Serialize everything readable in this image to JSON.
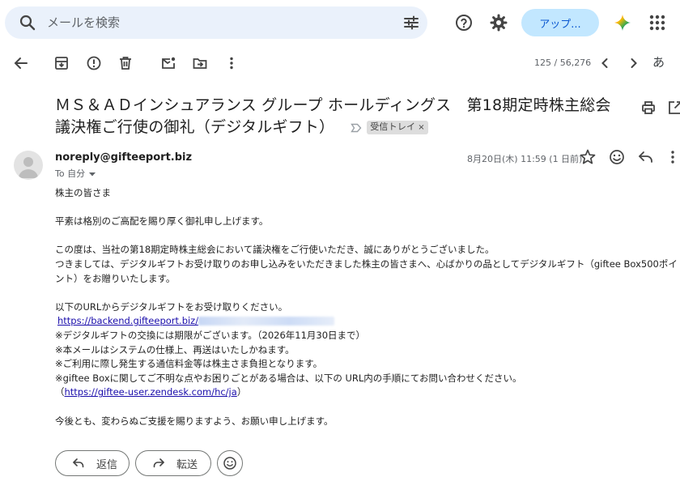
{
  "search": {
    "placeholder": "メールを検索"
  },
  "header": {
    "upgrade_label": "アップ..."
  },
  "toolbar": {
    "count": "125 / 56,276",
    "lang": "あ"
  },
  "email": {
    "subject_line1": "ＭＳ＆ＡＤインシュアランス グループ ホールディングス　第18期定時株主総会",
    "subject_line2": "議決権ご行使の御礼（デジタルギフト）",
    "label": "受信トレイ",
    "label_close": "×",
    "sender": "noreply@gifteeport.biz",
    "to": "To 自分",
    "date": "8月20日(木) 11:59 (1 日前)",
    "body": {
      "greeting": "株主の皆さま",
      "p1": "平素は格別のご高配を賜り厚く御礼申し上げます。",
      "p2a": "この度は、当社の第18期定時株主総会において議決権をご行使いただき、誠にありがとうございました。",
      "p2b": "つきましては、デジタルギフトお受け取りのお申し込みをいただきました株主の皆さまへ、心ばかりの品としてデジタルギフト（giftee Box500ポイ",
      "p2c": "ント）をお贈りいたします。",
      "p3": "以下のURLからデジタルギフトをお受け取りください。",
      "url": "https://backend.gifteeport.biz/",
      "n1": "※デジタルギフトの交換には期限がございます。（2026年11月30日まで）",
      "n2": "※本メールはシステムの仕様上、再送はいたしかねます。",
      "n3": "※ご利用に際し発生する通信料金等は株主さま負担となります。",
      "n4": "※giftee Boxに関してご不明な点やお困りごとがある場合は、以下の URL内の手順にてお問い合わせください。",
      "help_open": "（",
      "help_url": "https://giftee-user.zendesk.com/hc/ja",
      "help_close": "）",
      "closing": "今後とも、変わらぬご支援を賜りますよう、お願い申し上げます。"
    }
  },
  "actions": {
    "reply": "返信",
    "forward": "転送"
  },
  "colors": {
    "search_bg": "#eaf1fb",
    "upgrade_bg": "#c2e7ff",
    "upgrade_text": "#0b57d0",
    "link": "#1a0dab"
  }
}
